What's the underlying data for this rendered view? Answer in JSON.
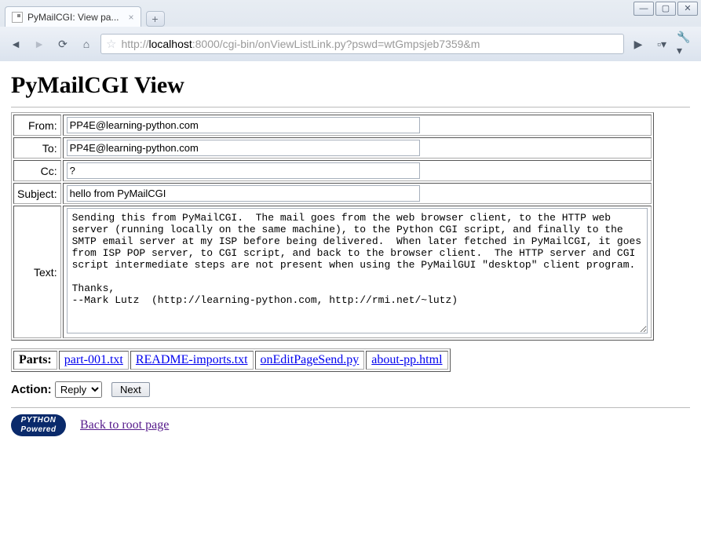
{
  "browser": {
    "tab_title": "PyMailCGI: View pa...",
    "url_prefix": "http://",
    "url_host": "localhost",
    "url_rest": ":8000/cgi-bin/onViewListLink.py?pswd=wtGmpsjeb7359&m"
  },
  "page": {
    "title": "PyMailCGI View",
    "fields": {
      "from_label": "From:",
      "from_value": "PP4E@learning-python.com",
      "to_label": "To:",
      "to_value": "PP4E@learning-python.com",
      "cc_label": "Cc:",
      "cc_value": "?",
      "subject_label": "Subject:",
      "subject_value": "hello from PyMailCGI",
      "text_label": "Text:",
      "text_value": "Sending this from PyMailCGI.  The mail goes from the web browser client, to the HTTP web server (running locally on the same machine), to the Python CGI script, and finally to the SMTP email server at my ISP before being delivered.  When later fetched in PyMailCGI, it goes from ISP POP server, to CGI script, and back to the browser client.  The HTTP server and CGI script intermediate steps are not present when using the PyMailGUI \"desktop\" client program.\n\nThanks,\n--Mark Lutz  (http://learning-python.com, http://rmi.net/~lutz)"
    },
    "parts_label": "Parts:",
    "parts": [
      "part-001.txt",
      "README-imports.txt",
      "onEditPageSend.py",
      "about-pp.html"
    ],
    "action": {
      "label": "Action:",
      "selected": "Reply",
      "next_label": "Next"
    },
    "footer": {
      "badge_line1": "PYTHON",
      "badge_line2": "Powered",
      "back_link": "Back to root page"
    }
  }
}
